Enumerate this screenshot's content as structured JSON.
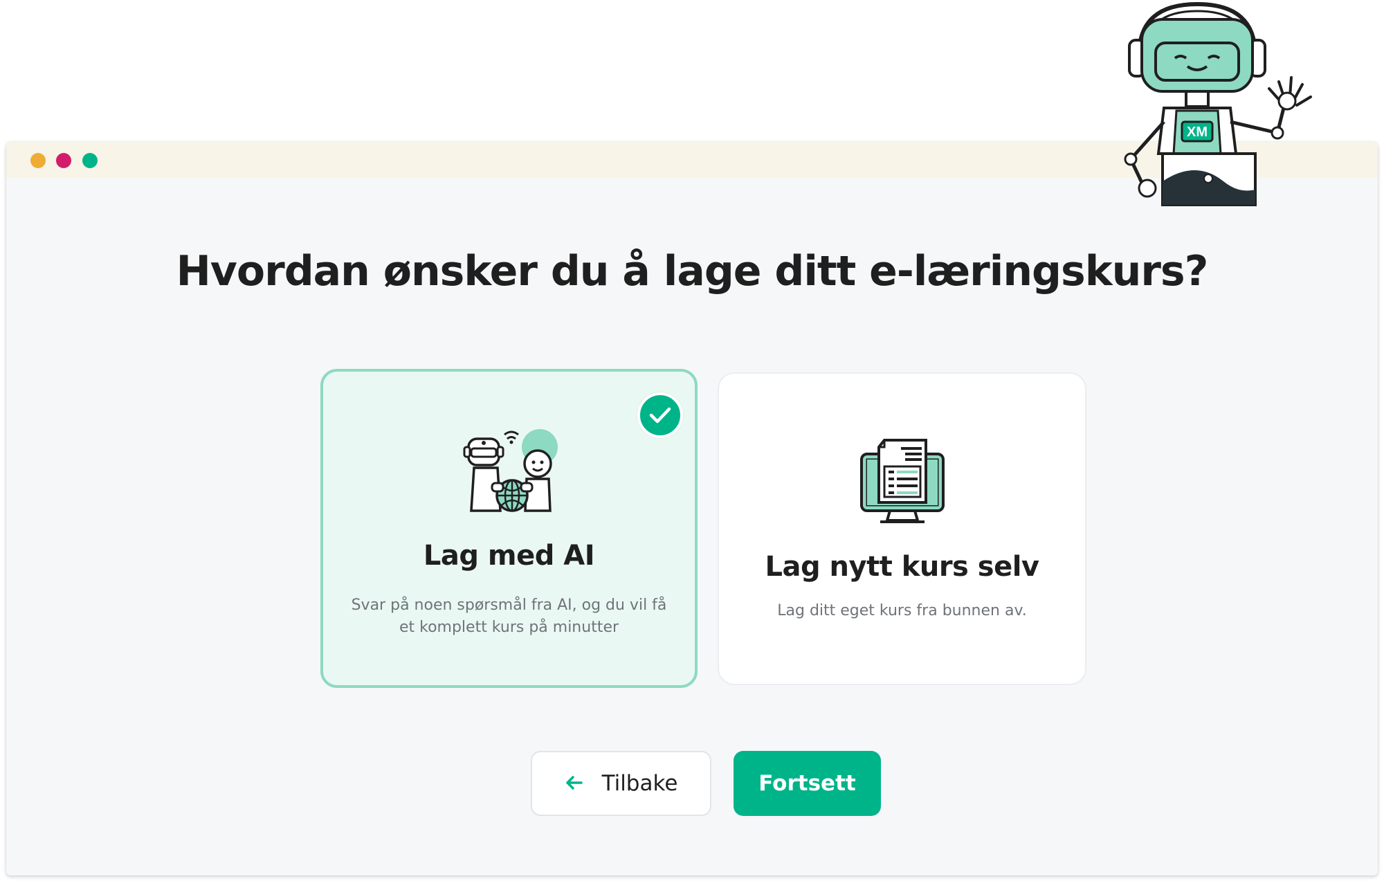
{
  "colors": {
    "accent": "#00b489",
    "accent_light": "#8dd9c2",
    "selected_bg": "#eaf8f3",
    "window_dots": [
      "#efac35",
      "#d41d6a",
      "#00b489"
    ]
  },
  "window": {
    "controls": [
      "window-dot-orange",
      "window-dot-pink",
      "window-dot-green"
    ]
  },
  "heading": "Hvordan ønsker du å lage ditt e-læringskurs?",
  "options": [
    {
      "title": "Lag med AI",
      "description": "Svar på noen spørsmål fra AI, og du vil få et komplett kurs på minutter",
      "icon": "ai-collaboration-icon",
      "selected": true
    },
    {
      "title": "Lag nytt kurs selv",
      "description": "Lag ditt eget kurs fra bunnen av.",
      "icon": "monitor-document-icon",
      "selected": false
    }
  ],
  "buttons": {
    "back_label": "Tilbake",
    "back_icon": "arrow-left-icon",
    "continue_label": "Fortsett"
  },
  "mascot": {
    "badge_text": "XM",
    "icon": "robot-mascot-icon"
  }
}
